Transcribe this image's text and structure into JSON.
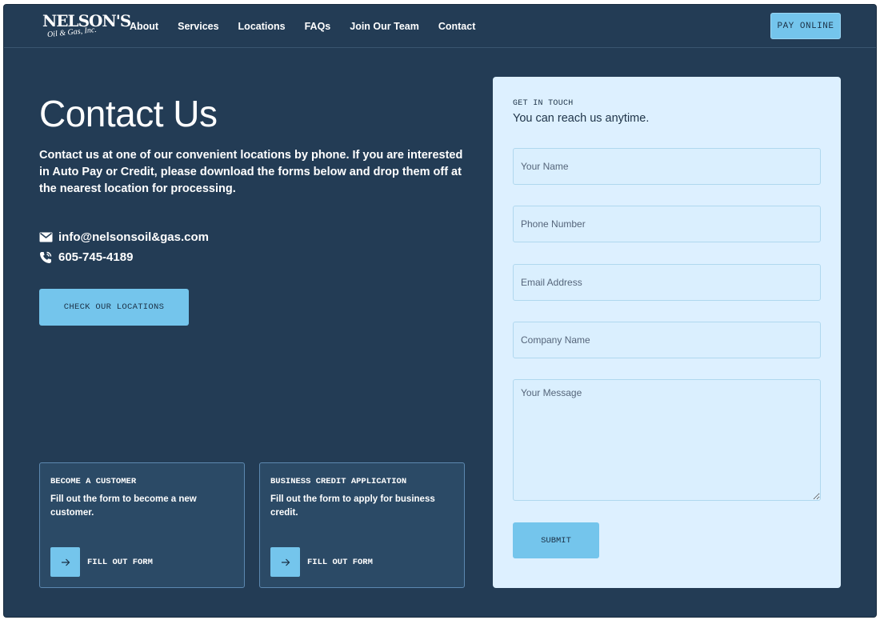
{
  "header": {
    "logo": {
      "line1": "NELSON'S",
      "line2": "Oil & Gas, Inc."
    },
    "nav": [
      {
        "label": "About"
      },
      {
        "label": "Services"
      },
      {
        "label": "Locations"
      },
      {
        "label": "FAQs"
      },
      {
        "label": "Join Our Team"
      },
      {
        "label": "Contact"
      }
    ],
    "pay_button": "PAY ONLINE"
  },
  "main": {
    "title": "Contact Us",
    "intro": "Contact us at one of our convenient locations by phone.  If you are interested in Auto Pay or Credit, please download the forms below and drop them off at the nearest location for processing.",
    "email": {
      "icon": "mail-icon",
      "value": "info@nelsonsoil&gas.com"
    },
    "phone": {
      "icon": "phone-icon",
      "value": "605-745-4189"
    },
    "locations_button": "CHECK OUR LOCATIONS",
    "cards": [
      {
        "title": "BECOME A CUSTOMER",
        "description": "Fill out the form to become a new customer.",
        "action": "FILL OUT FORM",
        "icon": "arrow-right-icon"
      },
      {
        "title": "BUSINESS CREDIT APPLICATION",
        "description": "Fill out the form to apply for business credit.",
        "action": "FILL OUT FORM",
        "icon": "arrow-right-icon"
      }
    ]
  },
  "form": {
    "eyebrow": "GET IN TOUCH",
    "subtitle": "You can reach us anytime.",
    "name_placeholder": "Your Name",
    "phone_placeholder": "Phone Number",
    "email_placeholder": "Email Address",
    "company_placeholder": "Company Name",
    "message_placeholder": "Your Message",
    "submit_label": "SUBMIT"
  },
  "colors": {
    "background": "#233c55",
    "accent": "#74c5ec",
    "form_panel": "#ddf0ff",
    "card_border": "#5c88b0"
  }
}
